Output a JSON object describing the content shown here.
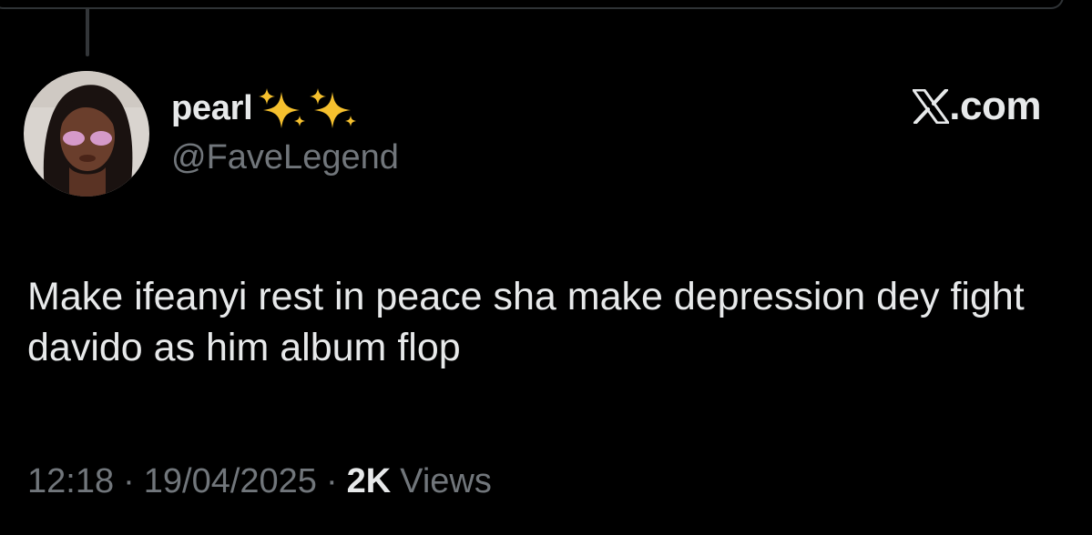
{
  "tweet": {
    "display_name": "pearl",
    "handle": "@FaveLegend",
    "brand_text": ".com",
    "body": "Make ifeanyi rest in peace sha make depression dey fight davido as him album flop",
    "time": "12:18",
    "separator": "·",
    "date": "19/04/2025",
    "views_count": "2K",
    "views_label": "Views"
  },
  "icons": {
    "sparkles": "sparkles-emoji-icon",
    "brand": "x-logo-icon"
  },
  "colors": {
    "background": "#000000",
    "primary_text": "#e7e9ea",
    "secondary_text": "#71767b",
    "border": "#2f3336",
    "sparkle": "#f5c02e"
  }
}
